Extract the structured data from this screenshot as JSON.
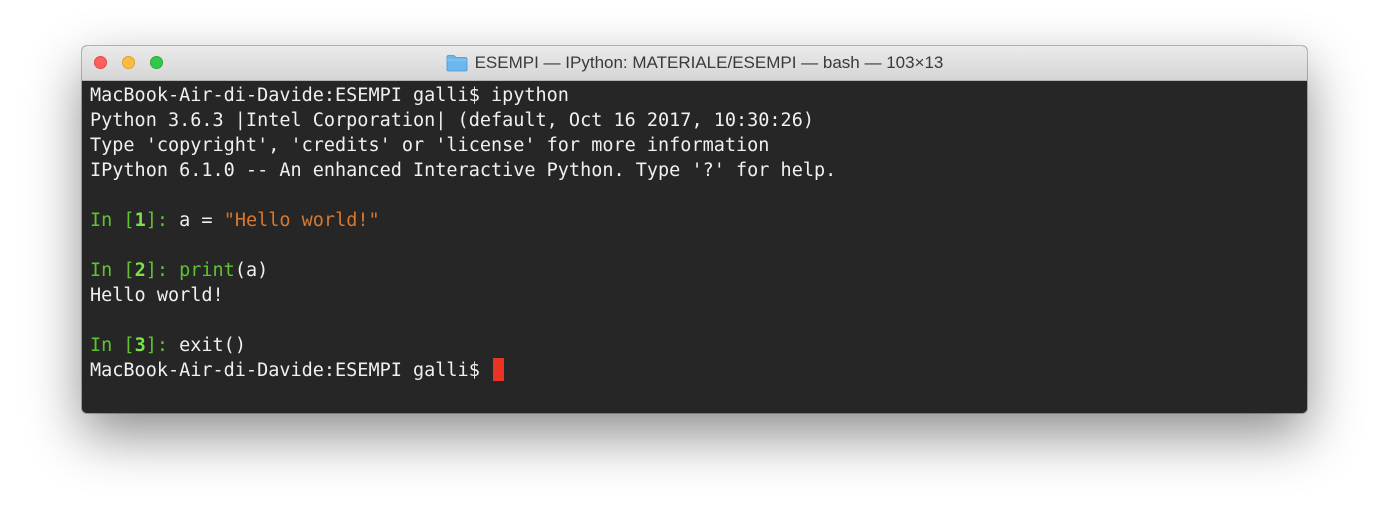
{
  "window": {
    "title": "ESEMPI — IPython: MATERIALE/ESEMPI — bash — 103×13"
  },
  "terminal": {
    "prompt1": "MacBook-Air-di-Davide:ESEMPI galli$ ",
    "cmd1": "ipython",
    "banner1": "Python 3.6.3 |Intel Corporation| (default, Oct 16 2017, 10:30:26)",
    "banner2": "Type 'copyright', 'credits' or 'license' for more information",
    "banner3": "IPython 6.1.0 -- An enhanced Interactive Python. Type '?' for help.",
    "cells": [
      {
        "in_label": "In [",
        "number": "1",
        "in_close": "]: ",
        "code_plain": "a = ",
        "code_string": "\"Hello world!\""
      },
      {
        "in_label": "In [",
        "number": "2",
        "in_close": "]: ",
        "code_builtin": "print",
        "code_plain": "(a)",
        "output": "Hello world!"
      },
      {
        "in_label": "In [",
        "number": "3",
        "in_close": "]: ",
        "code_plain": "exit()"
      }
    ],
    "prompt2": "MacBook-Air-di-Davide:ESEMPI galli$ "
  },
  "colors": {
    "prompt_green": "#5ec32f",
    "number_green": "#7be04a",
    "string_orange": "#d8782e",
    "cursor_red": "#ea3323",
    "background": "#262626",
    "text": "#f0f0f0"
  },
  "icons": {
    "title": "folder-icon",
    "close": "close-button",
    "minimize": "minimize-button",
    "zoom": "zoom-button"
  }
}
